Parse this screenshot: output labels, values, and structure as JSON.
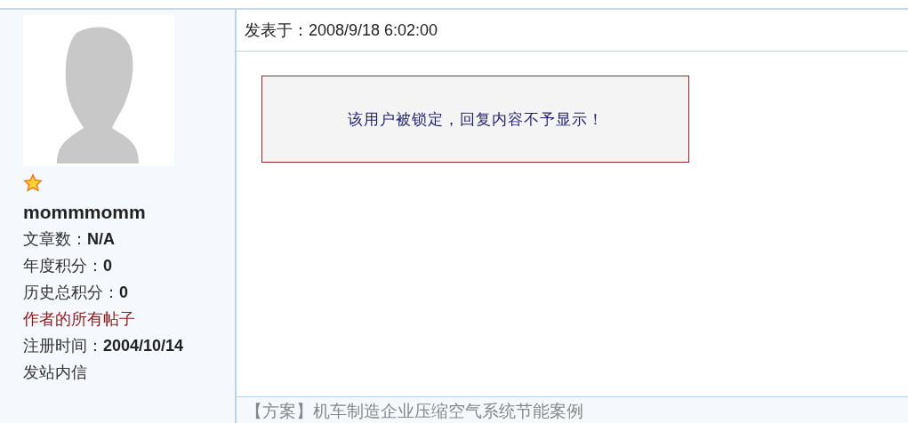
{
  "author": {
    "name": "mommmomm",
    "fields": [
      {
        "kind": "stat",
        "label": "文章数：",
        "value": "N/A"
      },
      {
        "kind": "stat",
        "label": "年度积分：",
        "value": "0"
      },
      {
        "kind": "stat",
        "label": "历史总积分：",
        "value": "0"
      },
      {
        "kind": "link",
        "label": "作者的所有帖子"
      },
      {
        "kind": "stat",
        "label": "注册时间：",
        "value": "2004/10/14"
      },
      {
        "kind": "plain",
        "label": "发站内信"
      }
    ]
  },
  "post": {
    "posted_label": "发表于：",
    "posted_time": "2008/9/18 6:02:00",
    "notice": "该用户被锁定，回复内容不予显示！"
  },
  "footer": {
    "next_title": "【方案】机车制造企业压缩空气系统节能案例"
  }
}
